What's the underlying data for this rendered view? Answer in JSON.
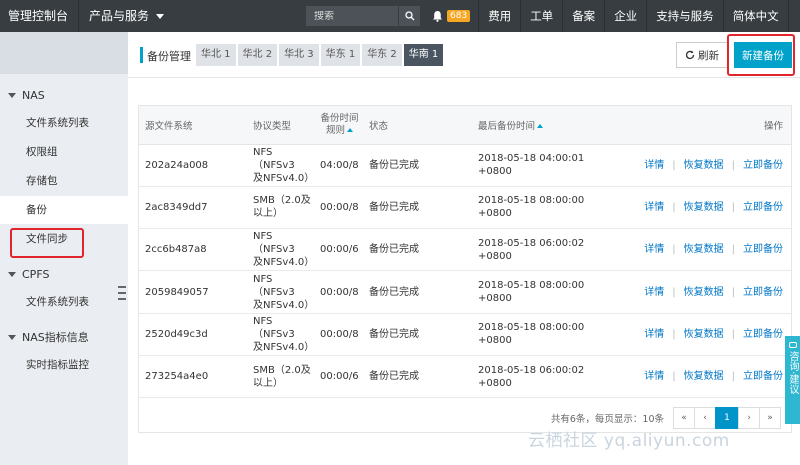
{
  "topbar": {
    "brand": "管理控制台",
    "products": "产品与服务",
    "search_placeholder": "搜索",
    "notif_count": "683",
    "nav": [
      "费用",
      "工单",
      "备案",
      "企业",
      "支持与服务",
      "简体中文"
    ]
  },
  "sidebar": {
    "groups": [
      {
        "label": "NAS",
        "items": [
          "文件系统列表",
          "权限组",
          "存储包",
          "备份",
          "文件同步"
        ]
      },
      {
        "label": "CPFS",
        "items": [
          "文件系统列表"
        ]
      },
      {
        "label": "NAS指标信息",
        "items": [
          "实时指标监控"
        ]
      }
    ],
    "active_item": "备份"
  },
  "header": {
    "title": "备份管理",
    "tabs": [
      "华北 1",
      "华北 2",
      "华北 3",
      "华东 1",
      "华东 2",
      "华南 1"
    ],
    "active_tab": "华南 1",
    "refresh_label": "刷新",
    "new_label": "新建备份"
  },
  "table": {
    "columns": {
      "source": "源文件系统",
      "protocol": "协议类型",
      "rule_l1": "备份时间",
      "rule_l2": "规则",
      "status": "状态",
      "last": "最后备份时间",
      "ops": "操作"
    },
    "op_labels": {
      "detail": "详情",
      "restore": "恢复数据",
      "backup_now": "立即备份"
    },
    "rows": [
      {
        "fs": "202a24a008",
        "proto1": "NFS（NFSv3",
        "proto2": "及NFSv4.0）",
        "rule": "04:00/8",
        "status": "备份已完成",
        "time1": "2018-05-18 04:00:01",
        "time2": "+0800"
      },
      {
        "fs": "2ac8349dd7",
        "proto1": "SMB（2.0及",
        "proto2": "以上）",
        "rule": "00:00/8",
        "status": "备份已完成",
        "time1": "2018-05-18 08:00:00",
        "time2": "+0800"
      },
      {
        "fs": "2cc6b487a8",
        "proto1": "NFS（NFSv3",
        "proto2": "及NFSv4.0）",
        "rule": "00:00/6",
        "status": "备份已完成",
        "time1": "2018-05-18 06:00:02",
        "time2": "+0800"
      },
      {
        "fs": "2059849057",
        "proto1": "NFS（NFSv3",
        "proto2": "及NFSv4.0）",
        "rule": "00:00/8",
        "status": "备份已完成",
        "time1": "2018-05-18 08:00:00",
        "time2": "+0800"
      },
      {
        "fs": "2520d49c3d",
        "proto1": "NFS（NFSv3",
        "proto2": "及NFSv4.0）",
        "rule": "00:00/8",
        "status": "备份已完成",
        "time1": "2018-05-18 08:00:00",
        "time2": "+0800"
      },
      {
        "fs": "273254a4e0",
        "proto1": "SMB（2.0及",
        "proto2": "以上）",
        "rule": "00:00/6",
        "status": "备份已完成",
        "time1": "2018-05-18 06:00:02",
        "time2": "+0800"
      }
    ]
  },
  "pager": {
    "info": "共有6条，每页显示：10条",
    "first": "«",
    "prev": "‹",
    "current": "1",
    "next": "›",
    "last": "»"
  },
  "feedback": "咨询·建议",
  "watermark": "云栖社区 yq.aliyun.com",
  "colors": {
    "accent": "#00a2ca",
    "topbar": "#373d41",
    "highlight": "#e0262c",
    "link": "#0077c8"
  }
}
